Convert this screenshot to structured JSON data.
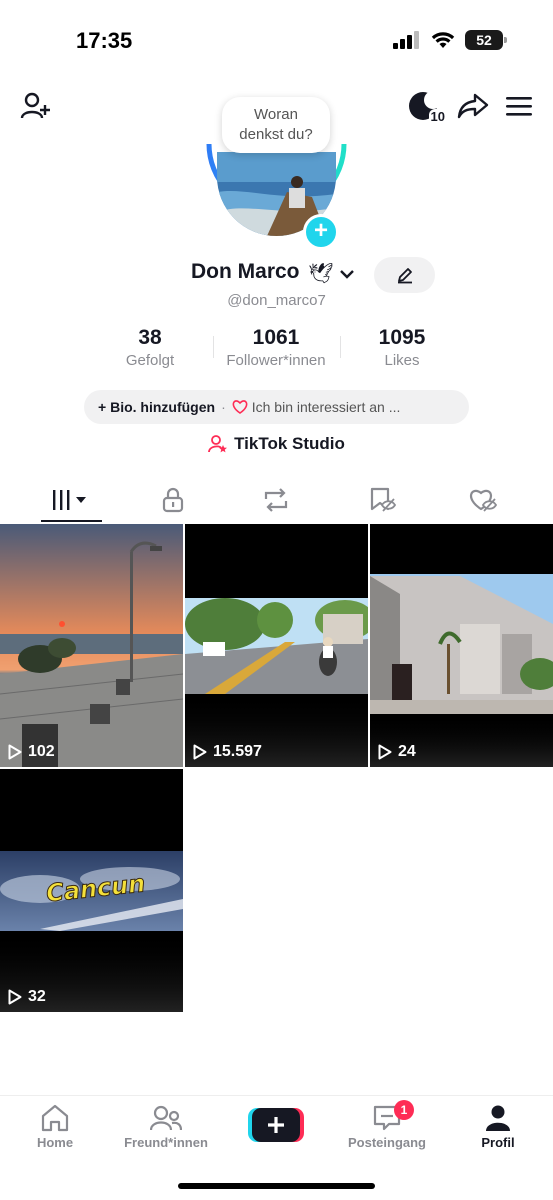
{
  "status_bar": {
    "time": "17:35",
    "battery": "52"
  },
  "header": {
    "moon_badge": "10",
    "thought_bubble_line1": "Woran",
    "thought_bubble_line2": "denkst du?"
  },
  "profile": {
    "name": "Don Marco",
    "handle": "@don_marco7",
    "stats": [
      {
        "value": "38",
        "label": "Gefolgt"
      },
      {
        "value": "1061",
        "label": "Follower*innen"
      },
      {
        "value": "1095",
        "label": "Likes"
      }
    ],
    "bio_add": "Bio. hinzufügen",
    "bio_interest": "Ich bin interessiert an ...",
    "studio": "TikTok Studio"
  },
  "videos": [
    {
      "views": "102"
    },
    {
      "views": "15.597"
    },
    {
      "views": "24"
    },
    {
      "views": "32",
      "overlay_text": "Cancun"
    }
  ],
  "bottom_nav": {
    "home": "Home",
    "friends": "Freund*innen",
    "inbox": "Posteingang",
    "inbox_badge": "1",
    "profile": "Profil"
  },
  "colors": {
    "accent_teal": "#20d5ec",
    "accent_red": "#fe2c55",
    "text": "#161823",
    "muted": "#8a8b91"
  }
}
